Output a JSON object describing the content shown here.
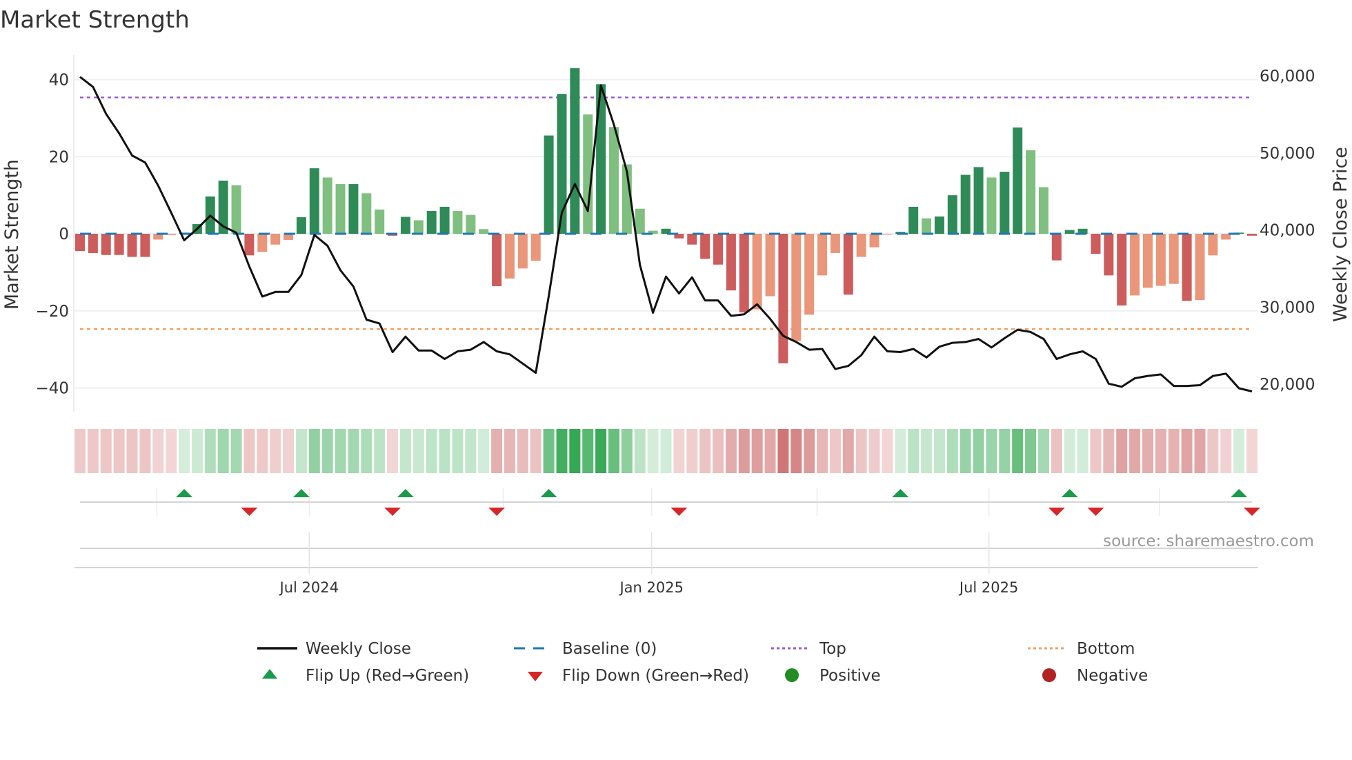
{
  "chart_data": {
    "type": "bar",
    "title": "Market Strength",
    "ylabel": "Market Strength",
    "y2label": "Weekly Close Price",
    "ylim": [
      -42,
      46
    ],
    "y2lim": [
      20000,
      60000
    ],
    "yticks": [
      40,
      20,
      0,
      -20,
      -40
    ],
    "ytick_labels": [
      "40",
      "20",
      "0",
      "−20",
      "−40"
    ],
    "y2ticks": [
      60000,
      50000,
      40000,
      30000,
      20000
    ],
    "y2tick_labels": [
      "60,000",
      "50,000",
      "40,000",
      "30,000",
      "20,000"
    ],
    "xtick_labels": [
      {
        "label": "Jul 2024",
        "week_index": 17.6
      },
      {
        "label": "Jan 2025",
        "week_index": 43.9
      },
      {
        "label": "Jul 2025",
        "week_index": 69.8
      }
    ],
    "quarter_gridlines_week_index": [
      5.9,
      17.6,
      32.5,
      43.9,
      56.6,
      69.8,
      82.9
    ],
    "top_level": 35.4,
    "bottom_level": -24.7,
    "baseline": 0,
    "strength": [
      -4.5,
      -5,
      -5.5,
      -5.5,
      -6,
      -6,
      -1.5,
      -0.3,
      0.3,
      2.5,
      9.7,
      13.8,
      12.6,
      -5.6,
      -4.7,
      -2.8,
      -1.6,
      4.3,
      17,
      14.6,
      12.9,
      12.9,
      10.5,
      6.3,
      -0.5,
      4.4,
      3.5,
      5.9,
      7,
      5.9,
      4.9,
      1.2,
      -13.6,
      -11.6,
      -9,
      -7,
      25.5,
      36.3,
      43,
      31,
      38.8,
      27.7,
      18,
      6.5,
      0.8,
      1.3,
      -1.2,
      -2.8,
      -6.5,
      -8,
      -14.7,
      -20.4,
      -19.6,
      -16.2,
      -33.6,
      -27.8,
      -21,
      -10.8,
      -5,
      -15.8,
      -6,
      -3.5,
      -0.2,
      0.5,
      7,
      4,
      4.5,
      10,
      15.3,
      17.3,
      14.6,
      16.1,
      27.6,
      21.7,
      12.1,
      -6.9,
      1,
      1.3,
      -5.2,
      -10.8,
      -18.6,
      -16,
      -14,
      -13.5,
      -13,
      -17.4,
      -17.2,
      -5.6,
      -1.5,
      0.3,
      -0.5
    ],
    "weekly_close": [
      60400,
      59100,
      55600,
      53100,
      50200,
      49300,
      46300,
      42800,
      39200,
      40700,
      42400,
      41000,
      40200,
      35800,
      31900,
      32500,
      32500,
      34700,
      39900,
      38500,
      35300,
      33200,
      28900,
      28400,
      24700,
      26700,
      24900,
      24900,
      23800,
      24800,
      25000,
      26000,
      24800,
      24400,
      23200,
      22000,
      32000,
      42800,
      46500,
      43000,
      59300,
      54200,
      48100,
      36000,
      29800,
      34500,
      32300,
      34400,
      31400,
      31400,
      29400,
      29600,
      30900,
      29000,
      26800,
      26000,
      25000,
      25100,
      22500,
      22900,
      24300,
      26700,
      24800,
      24700,
      25100,
      24000,
      25400,
      25900,
      26000,
      26400,
      25300,
      26500,
      27600,
      27300,
      26400,
      23800,
      24400,
      24800,
      23800,
      20600,
      20200,
      21300,
      21600,
      21800,
      20300,
      20300,
      20400,
      21600,
      21900,
      20000,
      19600
    ],
    "flip_up_week_index": [
      8,
      17,
      25,
      36,
      63,
      76,
      89
    ],
    "flip_down_week_index": [
      13,
      24,
      32,
      46,
      75,
      78,
      90
    ],
    "source": "source: sharemaestro.com",
    "legend": {
      "placement": "bottom",
      "weekly_close": "Weekly Close",
      "baseline": "Baseline (0)",
      "top": "Top",
      "bottom": "Bottom",
      "flip_up": "Flip Up (Red→Green)",
      "flip_down": "Flip Down (Green→Red)",
      "positive": "Positive",
      "negative": "Negative"
    },
    "colors": {
      "pos_strong": "#2e8b57",
      "pos_weak": "#7fbf7f",
      "neg_strong": "#cd5c5c",
      "neg_weak": "#e9967a",
      "line": "#111111",
      "baseline": "#1f77b4",
      "top": "#9b59d0",
      "bottom": "#f0a060",
      "flip_up": "#1a9a4a",
      "flip_down": "#d62728",
      "positive": "#228b22",
      "negative": "#b22222"
    }
  }
}
